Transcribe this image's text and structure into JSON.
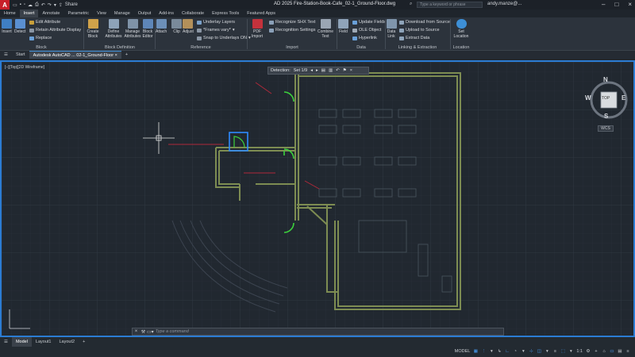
{
  "titlebar": {
    "logo": "A",
    "title": "AD 2025  Fire-Station-Book-Cafe_02-1_Ground-Floor.dwg",
    "search_placeholder": "Type a keyword or phrase",
    "user": "andy.manze@...",
    "share": "Share"
  },
  "ribbon_tabs": [
    "Home",
    "Insert",
    "Annotate",
    "Parametric",
    "View",
    "Manage",
    "Output",
    "Add-ins",
    "Collaborate",
    "Express Tools",
    "Featured Apps"
  ],
  "ribbon_active_tab": "Insert",
  "panels": {
    "block": {
      "label": "Block",
      "insert": "Insert",
      "detect": "Detect",
      "edit_attribute": "Edit Attribute",
      "retain_attribute_display": "Retain Attribute Display",
      "replace": "Replace"
    },
    "block_definition": {
      "label": "Block Definition",
      "create_block": "Create Block",
      "define_attributes": "Define Attributes",
      "manage_attributes": "Manage Attributes",
      "block_editor": "Block Editor"
    },
    "reference": {
      "label": "Reference",
      "attach": "Attach",
      "clip": "Clip",
      "adjust": "Adjust",
      "underlay_layers": "Underlay Layers",
      "frames_vary": "*Frames vary*",
      "snap_to_underlays": "Snap to Underlays ON"
    },
    "import": {
      "label": "Import",
      "pdf_import": "PDF Import",
      "recognize_shx": "Recognize SHX Text",
      "recognition_settings": "Recognition Settings",
      "combine_text": "Combine Text"
    },
    "data": {
      "label": "Data",
      "field": "Field",
      "update_fields": "Update Fields",
      "ole_object": "OLE Object",
      "hyperlink": "Hyperlink"
    },
    "linking": {
      "label": "Linking & Extraction",
      "data_link": "Data Link",
      "download_from_source": "Download from Source",
      "upload_to_source": "Upload to Source",
      "extract_data": "Extract  Data"
    },
    "location": {
      "label": "Location",
      "set_location": "Set Location"
    }
  },
  "file_tabs": {
    "start": "Start",
    "active": "Autodesk AutoCAD ... 02-1_Ground-Floor",
    "add": "+"
  },
  "viewport": {
    "label": "[–][Top][2D Wireframe]",
    "detection_label": "Detection:",
    "detection_set": "Set 1/9"
  },
  "viewcube": {
    "n": "N",
    "s": "S",
    "e": "E",
    "w": "W",
    "top": "TOP",
    "wcs": "WCS"
  },
  "command": {
    "placeholder": "Type  a  command"
  },
  "layout_tabs": [
    "Model",
    "Layout1",
    "Layout2"
  ],
  "layout_active": "Model",
  "status": {
    "model": "MODEL",
    "scale": "1:1"
  },
  "colors": {
    "accent": "#2b7cd3",
    "walls": "#8a9a5a",
    "door": "#3cd23c",
    "selection": "#2e8bff",
    "red_lines": "#b0283a",
    "cursor": "#e6e6e6"
  }
}
